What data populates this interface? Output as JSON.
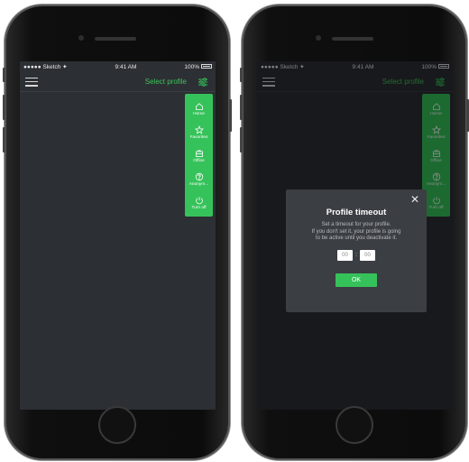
{
  "status_bar": {
    "carrier": "●●●●● Sketch",
    "wifi": "✦",
    "time": "9:41 AM",
    "battery": "100%"
  },
  "navbar": {
    "title": "Select profile"
  },
  "menu": {
    "items": [
      {
        "label": "Home",
        "icon": "home-icon"
      },
      {
        "label": "Favorites",
        "icon": "star-icon"
      },
      {
        "label": "Office",
        "icon": "briefcase-icon"
      },
      {
        "label": "Anonym...",
        "icon": "question-icon"
      },
      {
        "label": "Turn off",
        "icon": "power-icon"
      }
    ]
  },
  "dialog": {
    "title": "Profile timeout",
    "desc_line1": "Set a timeout for your profile.",
    "desc_line2": "If you don't set it, your profile is going",
    "desc_line3": "to be active until you deactivate it.",
    "hours": "00",
    "separator": ":",
    "minutes": "00",
    "ok_label": "OK",
    "close_symbol": "✕"
  },
  "colors": {
    "accent": "#36c25a",
    "screen_bg": "#2c2f33"
  }
}
